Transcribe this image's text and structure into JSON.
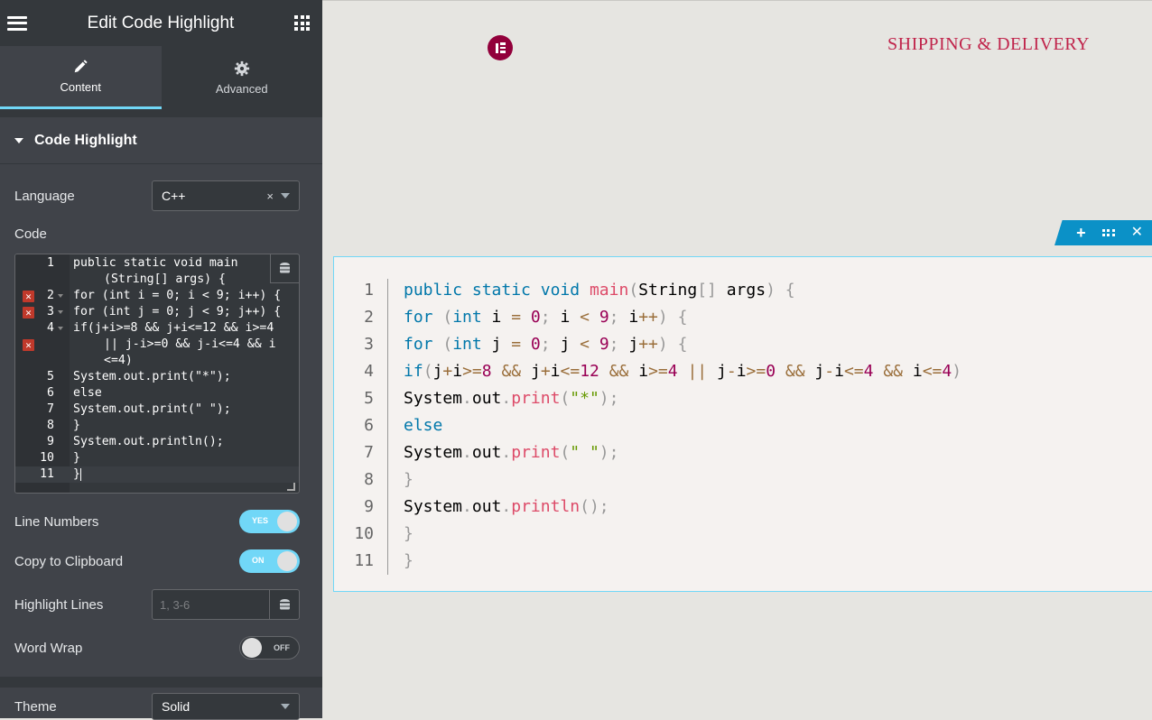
{
  "panel": {
    "title": "Edit Code Highlight",
    "tabs": [
      {
        "label": "Content",
        "icon": "pencil-icon"
      },
      {
        "label": "Advanced",
        "icon": "gear-icon"
      }
    ],
    "section": {
      "title": "Code Highlight"
    },
    "language": {
      "label": "Language",
      "value": "C++"
    },
    "code": {
      "label": "Code",
      "lines": [
        {
          "num": "1",
          "text": "public static void main",
          "wrap": "(String[] args) {",
          "error": false,
          "fold": false
        },
        {
          "num": "2",
          "text": "for (int i = 0; i < 9; i++) {",
          "error": true,
          "fold": true
        },
        {
          "num": "3",
          "text": "for (int j = 0; j < 9; j++) {",
          "error": true,
          "fold": true
        },
        {
          "num": "4",
          "text": "if(j+i>=8 && j+i<=12 && i>=4",
          "wrap": "|| j-i>=0 && j-i<=4 && i",
          "wrap2": "<=4)",
          "error": true,
          "fold": true
        },
        {
          "num": "5",
          "text": "System.out.print(\"*\");"
        },
        {
          "num": "6",
          "text": "else"
        },
        {
          "num": "7",
          "text": "System.out.print(\" \");"
        },
        {
          "num": "8",
          "text": "}"
        },
        {
          "num": "9",
          "text": "System.out.println();"
        },
        {
          "num": "10",
          "text": "}"
        },
        {
          "num": "11",
          "text": "}"
        }
      ]
    },
    "line_numbers": {
      "label": "Line Numbers",
      "state": "YES"
    },
    "copy_clipboard": {
      "label": "Copy to Clipboard",
      "state": "ON"
    },
    "highlight_lines": {
      "label": "Highlight Lines",
      "placeholder": "1, 3-6"
    },
    "word_wrap": {
      "label": "Word Wrap",
      "state": "OFF"
    },
    "theme": {
      "label": "Theme",
      "value": "Solid"
    }
  },
  "preview": {
    "nav_link": "SHIPPING & DELIVERY",
    "code_lines": [
      "1",
      "2",
      "3",
      "4",
      "5",
      "6",
      "7",
      "8",
      "9",
      "10",
      "11"
    ]
  },
  "colors": {
    "accent": "#71d7f7",
    "brand": "#92003b",
    "handle": "#0b91c7",
    "link": "#c0244b"
  }
}
